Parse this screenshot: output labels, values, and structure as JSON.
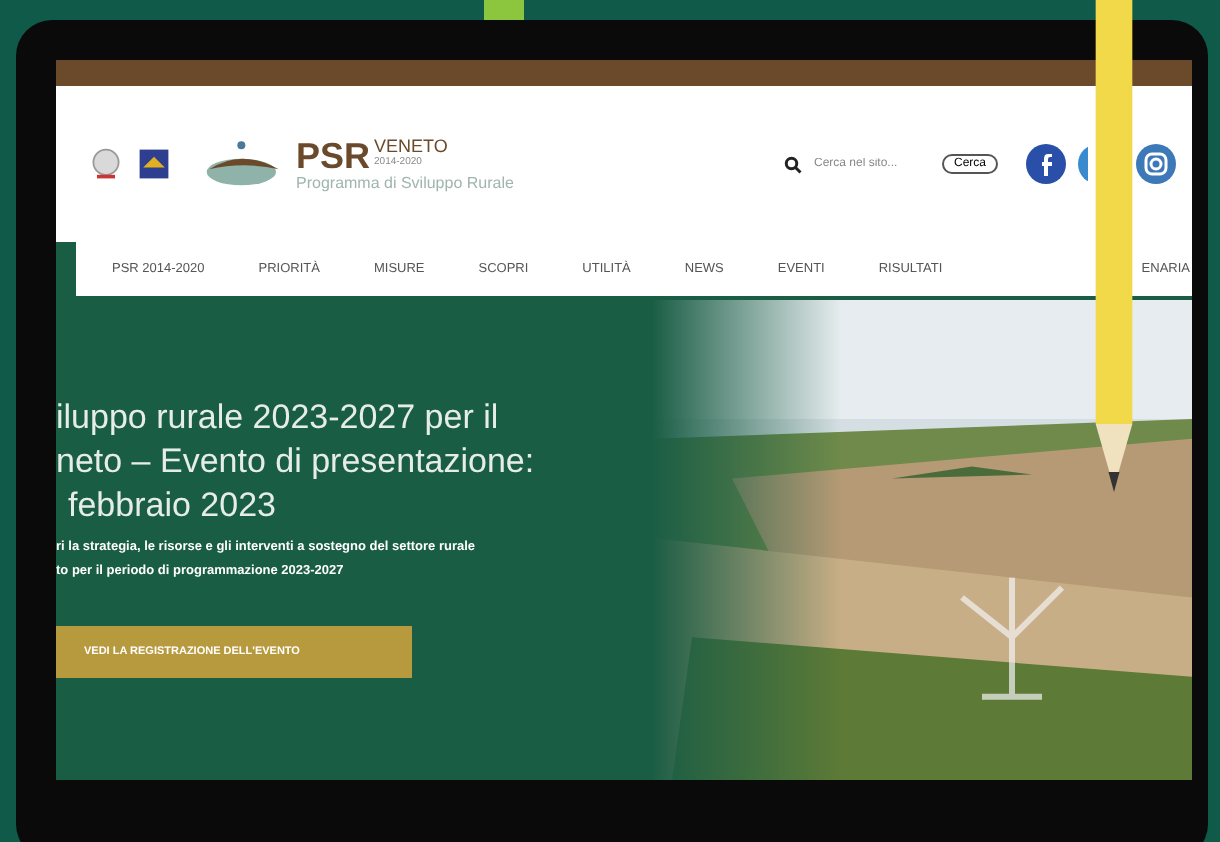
{
  "logo": {
    "name": "PSR",
    "region": "VENETO",
    "years": "2014-2020",
    "subtitle": "Programma di Sviluppo Rurale"
  },
  "search": {
    "placeholder": "Cerca nel sito...",
    "button": "Cerca"
  },
  "nav": [
    {
      "label": "PSR 2014-2020",
      "selected": false
    },
    {
      "label": "PRIORITÀ",
      "selected": false
    },
    {
      "label": "MISURE",
      "selected": false
    },
    {
      "label": "SCOPRI",
      "selected": false
    },
    {
      "label": "UTILITÀ",
      "selected": false
    },
    {
      "label": "NEWS",
      "selected": false
    },
    {
      "label": "EVENTI",
      "selected": false
    },
    {
      "label": "RISULTATI",
      "selected": false
    },
    {
      "label": "ENARIA",
      "selected": false
    }
  ],
  "hero": {
    "title_lines": [
      "iluppo rurale 2023-2027 per il",
      "neto – Evento di presentazione:",
      "febbraio 2023"
    ],
    "text_lines": [
      "ri la strategia, le risorse e gli interventi a sostegno del settore rurale",
      "to per il periodo di programmazione 2023-2027"
    ],
    "button": "VEDI LA REGISTRAZIONE DELL'EVENTO"
  }
}
